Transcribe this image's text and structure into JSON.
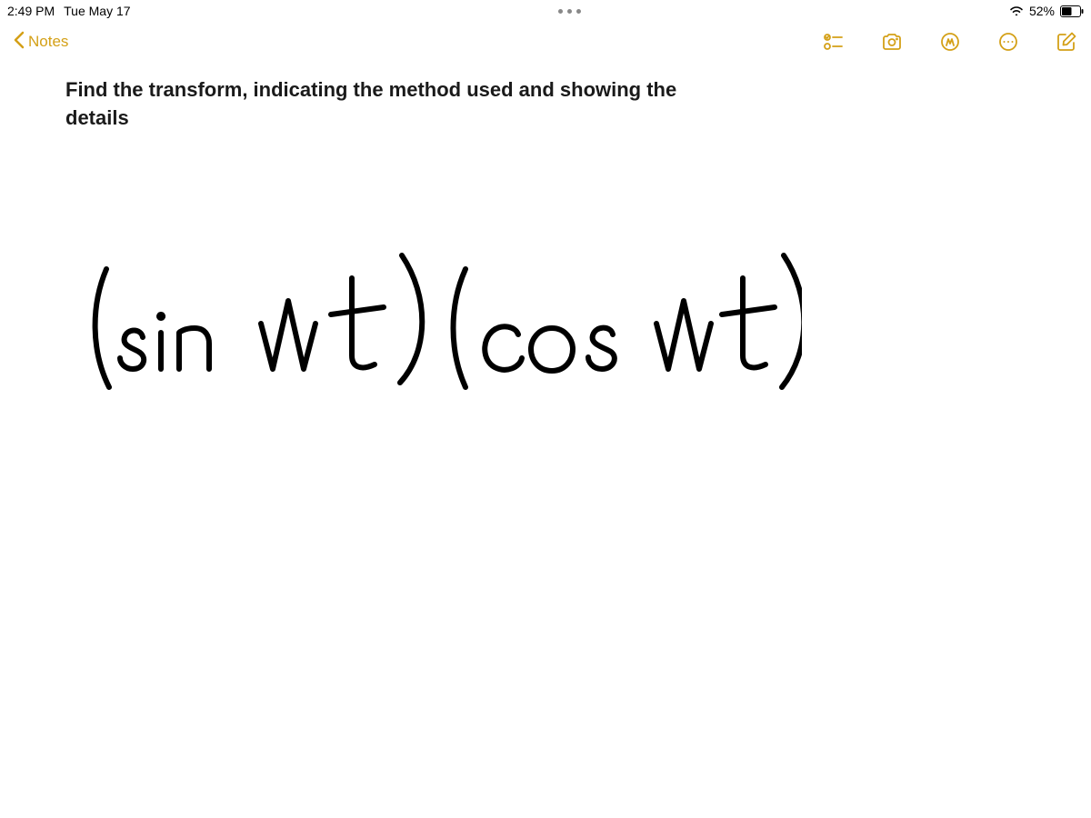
{
  "status_bar": {
    "time": "2:49 PM",
    "date": "Tue May 17",
    "battery_percent": "52%"
  },
  "nav": {
    "back_label": "Notes"
  },
  "note": {
    "title": "Find the transform, indicating the method used and showing the details",
    "handwritten_expression": "(sin wt)(cos wt)"
  },
  "colors": {
    "accent": "#d4a017"
  }
}
